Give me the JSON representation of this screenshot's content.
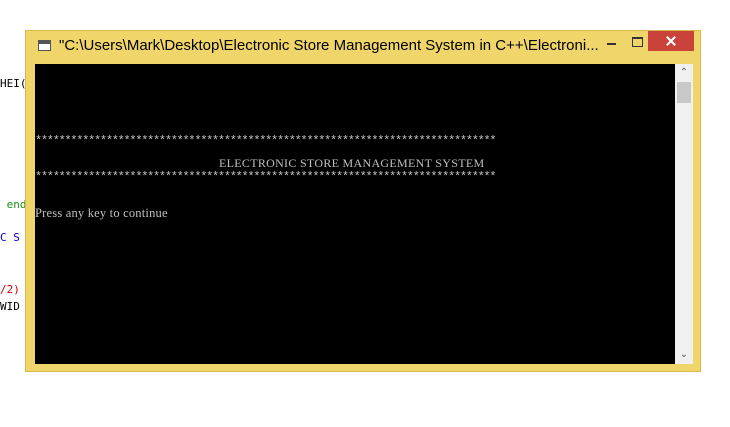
{
  "background_code": [
    {
      "text": "HEI(",
      "color": "#000000"
    },
    {
      "text": " end",
      "color": "#1a8f1a"
    },
    {
      "text": "C S",
      "color": "#0000cc"
    },
    {
      "text": "/2)",
      "color": "#cc0000"
    },
    {
      "text": "WID",
      "color": "#000000"
    }
  ],
  "window": {
    "title": "\"C:\\Users\\Mark\\Desktop\\Electronic Store Management System in C++\\Electroni...",
    "accent_color": "#f0d56a",
    "close_color": "#c9433b"
  },
  "console": {
    "stars_line": "******************************************************************************",
    "heading": "ELECTRONIC STORE MANAGEMENT SYSTEM",
    "prompt": "Press any key to continue"
  },
  "icons": {
    "app": "console-app-icon",
    "minimize": "minimize-icon",
    "maximize": "maximize-icon",
    "close": "close-icon",
    "scroll_up": "chevron-up-icon",
    "scroll_down": "chevron-down-icon"
  }
}
